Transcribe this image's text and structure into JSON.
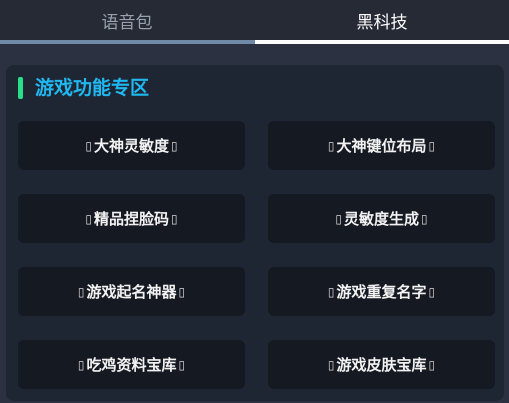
{
  "tabs": [
    {
      "label": "语音包",
      "active": false
    },
    {
      "label": "黑科技",
      "active": true
    }
  ],
  "section": {
    "title": "游戏功能专区"
  },
  "buttons": [
    {
      "label": "大神灵敏度"
    },
    {
      "label": "大神键位布局"
    },
    {
      "label": "精品捏脸码"
    },
    {
      "label": "灵敏度生成"
    },
    {
      "label": "游戏起名神器"
    },
    {
      "label": "游戏重复名字"
    },
    {
      "label": "吃鸡资料宝库"
    },
    {
      "label": "游戏皮肤宝库"
    }
  ],
  "glyph": "▯",
  "colors": {
    "accent": "#1fb8f0",
    "section_bar": "#27e08a",
    "button_bg": "#141922",
    "panel_bg": "#1f2633"
  }
}
